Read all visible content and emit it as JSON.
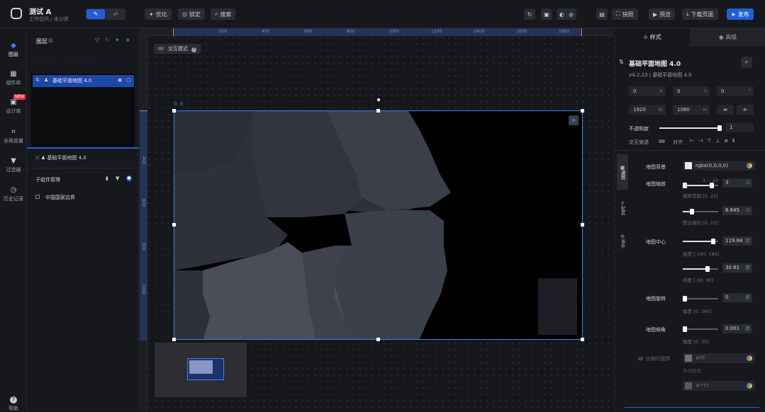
{
  "app": {
    "title": "测试 A",
    "breadcrumb_ws": "工作空间",
    "breadcrumb_sep": "/",
    "breadcrumb_cat": "未分类"
  },
  "topbar": {
    "btn_optimize": "优化",
    "btn_lock": "锁定",
    "btn_search": "搜索",
    "btn_snapshot": "快照",
    "btn_preview": "预览",
    "btn_download": "下载页面",
    "btn_publish": "发布"
  },
  "leftnav": {
    "items": [
      {
        "label": "图层",
        "icon": "layers-icon"
      },
      {
        "label": "组件库",
        "icon": "box-icon"
      },
      {
        "label": "设计库",
        "icon": "design-icon",
        "badge": "NEW"
      },
      {
        "label": "全局变量",
        "icon": "variable-icon"
      },
      {
        "label": "过滤器",
        "icon": "filter-icon"
      },
      {
        "label": "历史记录",
        "icon": "history-icon"
      },
      {
        "label": "帮助",
        "icon": "help-icon"
      }
    ]
  },
  "layers": {
    "title": "图层",
    "selected_item": "基础平面地图 4.0",
    "lower_item": "基础平面地图 4.0",
    "children_title": "子组件管理",
    "child_item": "中国国家边界"
  },
  "canvas": {
    "interaction_mode": "交互模式",
    "origin": "0, 0",
    "ruler_marks": [
      "200",
      "400",
      "600",
      "800",
      "1000",
      "1200",
      "1400",
      "1600",
      "1800"
    ],
    "vruler_marks": [
      "400",
      "600",
      "800",
      "1000"
    ]
  },
  "right": {
    "tab_style": "样式",
    "tab_advanced": "高级",
    "component_name": "基础平面地图 4.0",
    "version": "v4.2.23 | 基础平面地图 4.0",
    "x": "0",
    "x_unit": "X",
    "y": "0",
    "y_unit": "Y",
    "rot": "0",
    "rot_unit": "°",
    "w": "1920",
    "w_unit": "W",
    "h": "1080",
    "h_unit": "H",
    "opacity_label": "不透明度",
    "opacity": "1",
    "interaction_label": "交互穿透",
    "align_label": "对齐",
    "side_tabs": [
      "通用",
      "配置",
      "事件"
    ],
    "map_bg_label": "地图背景",
    "map_bg_value": "rgba(0,0,0,0)",
    "zoom_label": "地图缩放",
    "zoom_range": "3 ~ 20",
    "zoom_min": "3",
    "zoom_range_hint": "缩放范围 [0, 22]",
    "zoom_default": "6.645",
    "zoom_default_hint": "默认级别 [0, 22]",
    "center_label": "地图中心",
    "lng": "119.84",
    "lng_unit": "度",
    "lng_hint": "经度 [-180, 180]",
    "lat": "30.61",
    "lat_unit": "度",
    "lat_hint": "纬度 [-90, 90]",
    "rotate_label": "地图旋转",
    "rotate": "0",
    "rotate_unit": "度",
    "rotate_hint": "角度 [0, 360]",
    "tilt_label": "地图倾角",
    "tilt": "0.001",
    "tilt_unit": "度",
    "tilt_hint": "角度 [0, 30]",
    "scale_ctrl_label": "比例尺控件",
    "scale_color": "#fff",
    "scale_color_hint": "字体颜色",
    "scale_color2": "#777"
  }
}
